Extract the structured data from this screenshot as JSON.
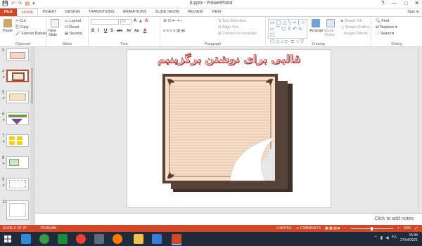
{
  "window": {
    "title": "6.pptx - PowerPoint",
    "controls": [
      "?",
      "—",
      "□",
      "✕"
    ]
  },
  "qat": [
    "💾",
    "↶",
    "↷",
    "▤",
    "▾"
  ],
  "tabs": [
    "FILE",
    "HOME",
    "INSERT",
    "DESIGN",
    "TRANSITIONS",
    "ANIMATIONS",
    "SLIDE SHOW",
    "REVIEW",
    "VIEW"
  ],
  "active_tab": "HOME",
  "sign_in": "Sign in",
  "ribbon": {
    "clipboard": {
      "label": "Clipboard",
      "paste": "Paste",
      "cut": "Cut",
      "copy": "Copy",
      "format_painter": "Format Painter"
    },
    "slides": {
      "label": "Slides",
      "new_slide": "New Slide",
      "layout": "Layout",
      "reset": "Reset",
      "section": "Section"
    },
    "font": {
      "label": "Font",
      "size": "20",
      "buttons": [
        "B",
        "I",
        "U",
        "S",
        "abc",
        "AV",
        "Aa",
        "A"
      ]
    },
    "paragraph": {
      "label": "Paragraph",
      "text_direction": "Text Direction",
      "align_text": "Align Text",
      "convert_smartart": "Convert to SmartArt"
    },
    "drawing": {
      "label": "Drawing",
      "arrange": "Arrange",
      "quick_styles": "Quick Styles",
      "shape_fill": "Shape Fill",
      "shape_outline": "Shape Outline",
      "shape_effects": "Shape Effects"
    },
    "editing": {
      "label": "Editing",
      "find": "Find",
      "replace": "Replace",
      "select": "Select"
    }
  },
  "thumbnails": [
    {
      "num": "3",
      "star": ""
    },
    {
      "num": "4",
      "star": "★"
    },
    {
      "num": "5",
      "star": "★"
    },
    {
      "num": "6",
      "star": "★"
    },
    {
      "num": "7",
      "star": "★"
    },
    {
      "num": "8",
      "star": "★"
    },
    {
      "num": "9",
      "star": "★"
    },
    {
      "num": "10",
      "star": ""
    }
  ],
  "slide": {
    "title": "قالبی برای نوشتن برگزینیم"
  },
  "notes_placeholder": "Click to add notes",
  "status": {
    "slide_info": "SLIDE 2 OF 27",
    "language": "PERSIAN",
    "notes": "NOTES",
    "comments": "COMMENTS",
    "zoom": "69%"
  },
  "taskbar": {
    "time": "15:45",
    "date": "27/04/2021",
    "lang": "FA"
  },
  "colors": {
    "accent": "#d24726",
    "taskbar": "#1f2a3a"
  }
}
